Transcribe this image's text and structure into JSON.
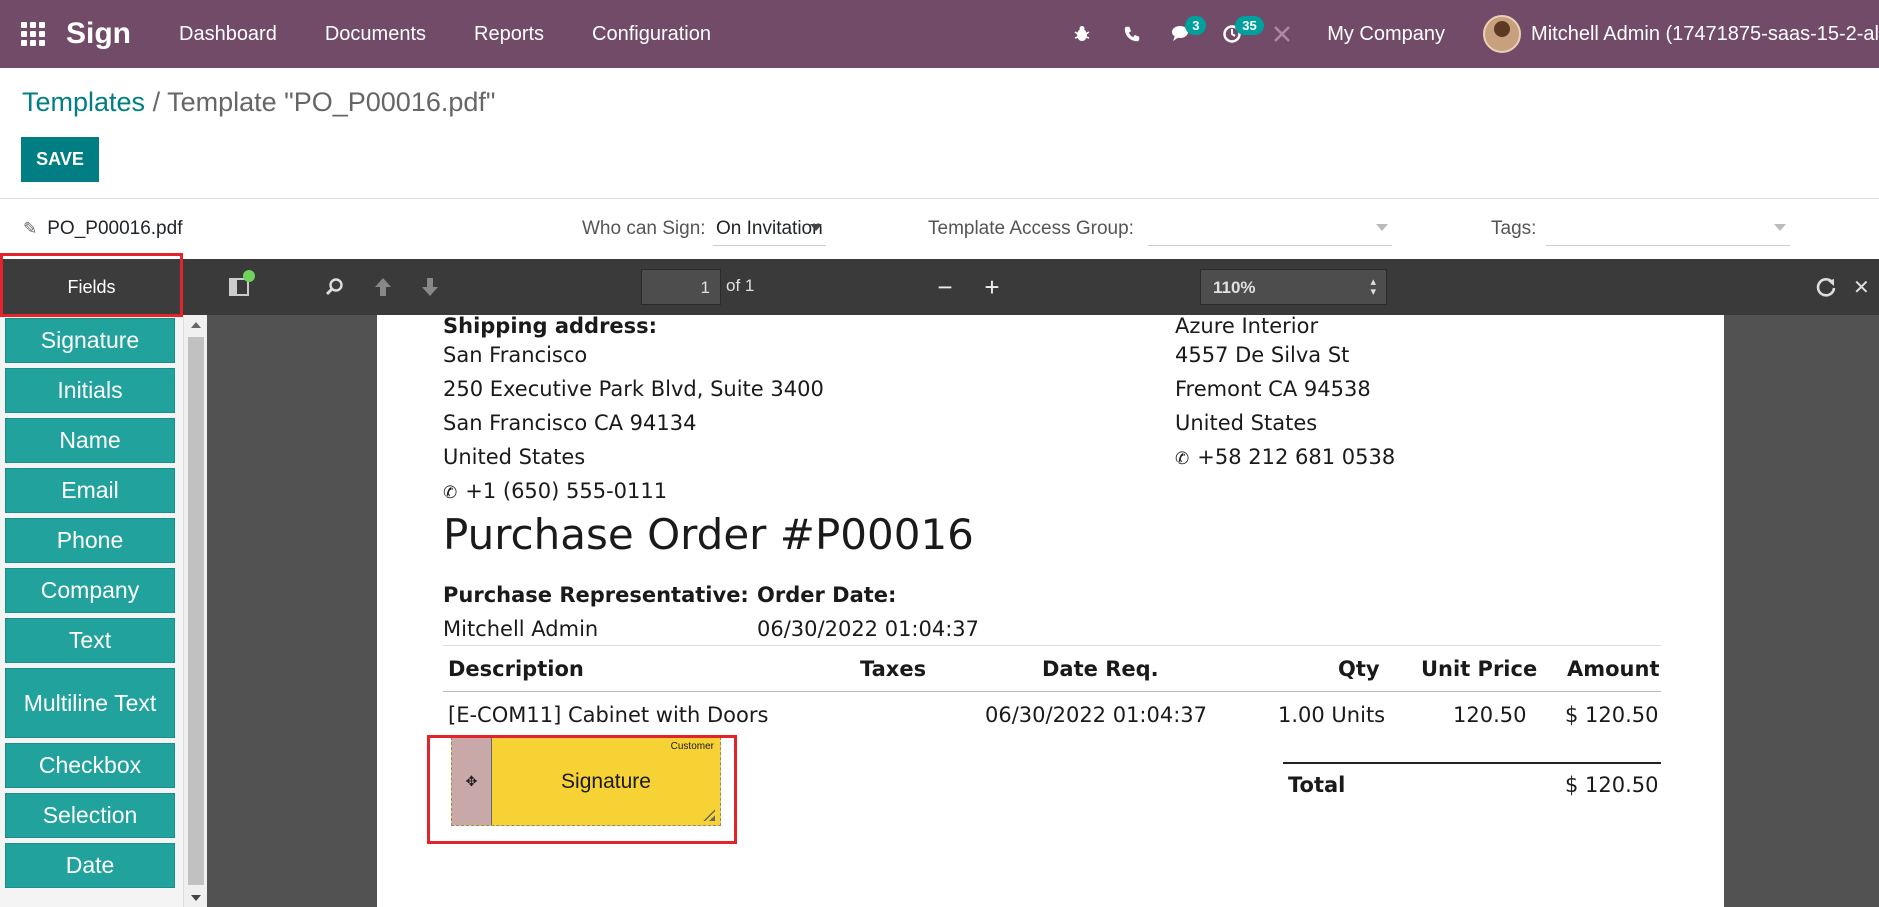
{
  "navbar": {
    "brand": "Sign",
    "menu": [
      "Dashboard",
      "Documents",
      "Reports",
      "Configuration"
    ],
    "messages_badge": "3",
    "activities_badge": "35",
    "company": "My Company",
    "user": "Mitchell Admin (17471875-saas-15-2-al",
    "icons": [
      "apps-grid-icon",
      "bug-icon",
      "phone-icon",
      "chat-icon",
      "clock-icon",
      "tools-icon"
    ]
  },
  "breadcrumb": {
    "parent": "Templates",
    "separator": " / ",
    "current": "Template \"PO_P00016.pdf\""
  },
  "actions": {
    "save": "SAVE"
  },
  "template_info": {
    "filename": "PO_P00016.pdf",
    "who_can_sign_label": "Who can Sign:",
    "who_can_sign_value": "On Invitation",
    "access_group_label": "Template Access Group:",
    "access_group_value": "",
    "tags_label": "Tags:",
    "tags_value": ""
  },
  "fields_panel": {
    "title": "Fields",
    "items": [
      "Signature",
      "Initials",
      "Name",
      "Email",
      "Phone",
      "Company",
      "Text",
      "Multiline Text",
      "Checkbox",
      "Selection",
      "Date"
    ]
  },
  "pdf_toolbar": {
    "page": "1",
    "of_label": "of 1",
    "zoom": "110%"
  },
  "document": {
    "shipping_label": "Shipping address:",
    "shipping_lines": [
      "San Francisco",
      "250 Executive Park Blvd, Suite 3400",
      "San Francisco CA 94134",
      "United States"
    ],
    "shipping_phone": "+1 (650) 555-0111",
    "vendor_lines": [
      "Azure Interior",
      "4557 De Silva St",
      "Fremont CA 94538",
      "United States"
    ],
    "vendor_phone": "+58 212 681 0538",
    "title": "Purchase Order #P00016",
    "rep_label": "Purchase Representative:",
    "rep_value": "Mitchell Admin",
    "date_label": "Order Date:",
    "date_value": "06/30/2022 01:04:37",
    "table_headers": [
      "Description",
      "Taxes",
      "Date Req.",
      "Qty",
      "Unit Price",
      "Amount"
    ],
    "table_row": [
      "[E-COM11] Cabinet with Doors",
      "",
      "06/30/2022 01:04:37",
      "1.00 Units",
      "120.50",
      "$ 120.50"
    ],
    "total_label": "Total",
    "total_value": "$ 120.50"
  },
  "signature_field": {
    "label": "Signature",
    "role": "Customer"
  },
  "colors": {
    "navbar": "#714b67",
    "accent": "#017e84",
    "field_button": "#21a29d",
    "signature_field": "#f7d234",
    "highlight": "#e3242b"
  }
}
